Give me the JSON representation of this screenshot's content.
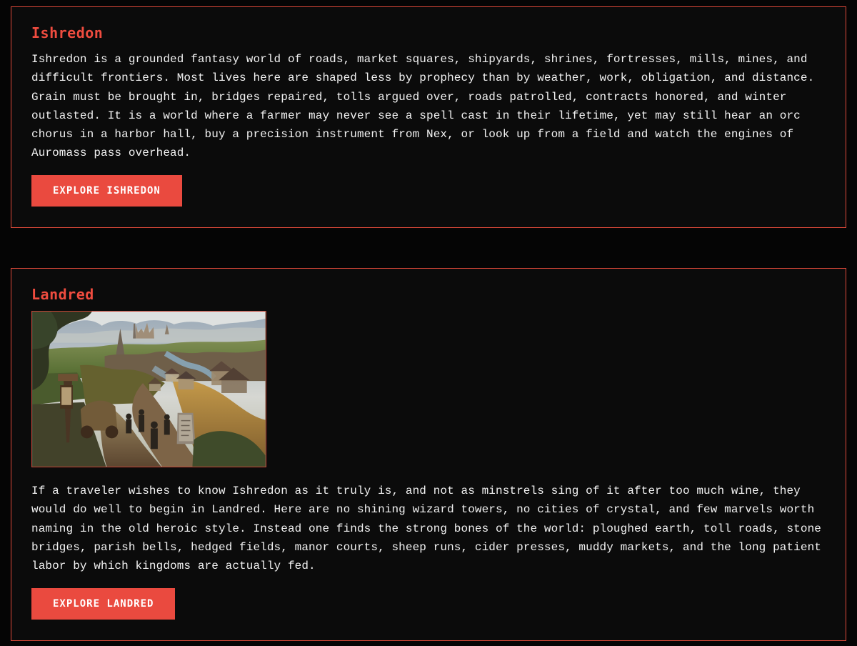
{
  "sections": [
    {
      "title": "Ishredon",
      "body": "Ishredon is a grounded fantasy world of roads, market squares, shipyards, shrines, fortresses, mills, mines, and difficult frontiers. Most lives here are shaped less by prophecy than by weather, work, obligation, and distance. Grain must be brought in, bridges repaired, tolls argued over, roads patrolled, contracts honored, and winter outlasted. It is a world where a farmer may never see a spell cast in their lifetime, yet may still hear an orc chorus in a harbor hall, buy a precision instrument from Nex, or look up from a field and watch the engines of Auromass pass overhead.",
      "cta_label": "EXPLORE ISHREDON"
    },
    {
      "title": "Landred",
      "body": "If a traveler wishes to know Ishredon as it truly is, and not as minstrels sing of it after too much wine, they would do well to begin in Landred. Here are no shining wizard towers, no cities of crystal, and few marvels worth naming in the old heroic style. Instead one finds the strong bones of the world: ploughed earth, toll roads, stone bridges, parish bells, hedged fields, manor courts, sheep runs, cider presses, muddy markets, and the long patient labor by which kingdoms are actually fed.",
      "cta_label": "EXPLORE LANDRED"
    }
  ],
  "colors": {
    "accent": "#ea4a3f",
    "panel_border": "#e04a3a",
    "background": "#050505",
    "panel_background": "#0b0b0b",
    "text": "#f2f2f2"
  }
}
